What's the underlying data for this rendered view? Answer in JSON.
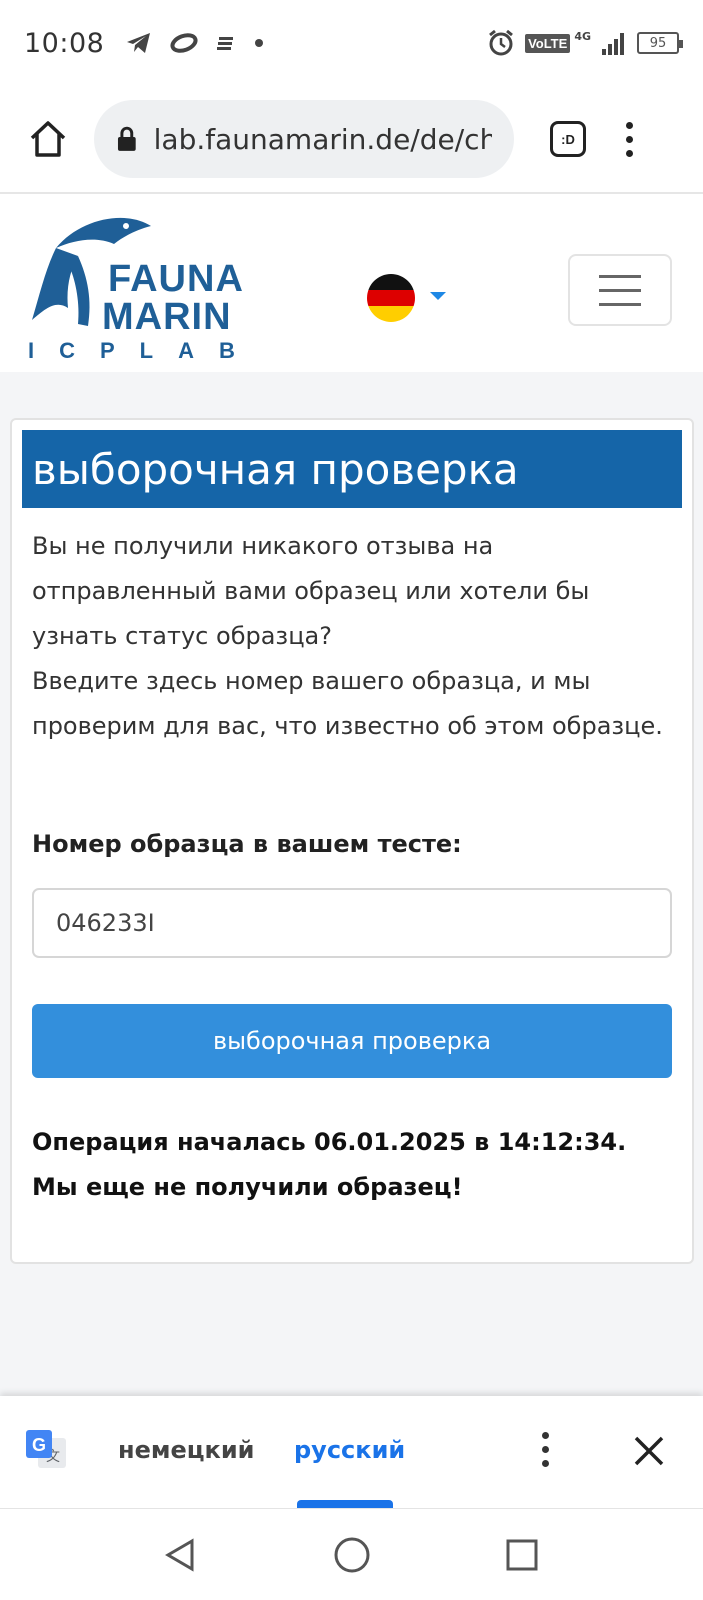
{
  "status_bar": {
    "time": "10:08",
    "network_label": "VoLTE",
    "network_type": "4G",
    "battery": "95",
    "icons": [
      "telegram-icon",
      "messaging-icon",
      "notification-icon",
      "dot-icon",
      "alarm-icon",
      "signal-icon",
      "battery-icon"
    ]
  },
  "browser": {
    "url": "lab.faunamarin.de/de/ch",
    "tabs_label": ":D"
  },
  "header": {
    "logo_line1": "FAUNA",
    "logo_line2": "MARIN",
    "logo_line3": "ICPLAB"
  },
  "card": {
    "title": "выборочная проверка",
    "description_line1": "Вы не получили никакого отзыва на отправленный вами образец или хотели бы узнать статус образца?",
    "description_line2": "Введите здесь номер вашего образца, и мы проверим для вас, что известно об этом образце.",
    "field_label": "Номер образца в вашем тесте:",
    "field_value": "046233I",
    "button_label": "выборочная проверка",
    "result_line1": "Операция началась 06.01.2025 в 14:12:34.",
    "result_line2": "Мы еще не получили образец!"
  },
  "translate_bar": {
    "source_lang": "немецкий",
    "target_lang": "русский",
    "active_color": "#1a73e8"
  },
  "colors": {
    "title_bg": "#1565a8",
    "button_bg": "#338fdc",
    "logo": "#1f5f97"
  }
}
